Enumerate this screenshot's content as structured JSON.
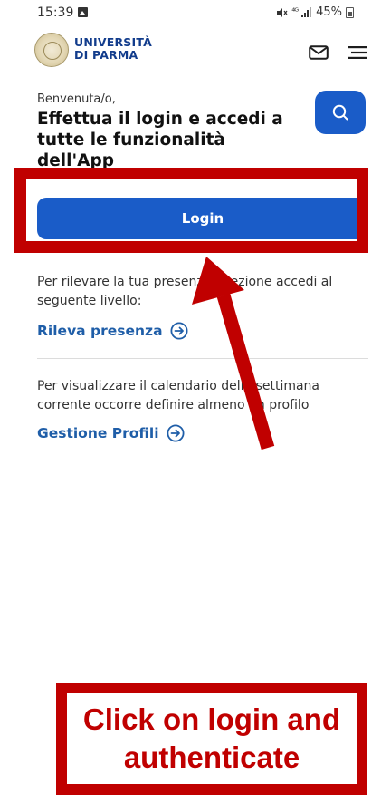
{
  "status_bar": {
    "time": "15:39",
    "signal_text": "⁴ᴳ",
    "battery": "45%"
  },
  "header": {
    "logo_line1": "UNIVERSITÀ",
    "logo_line2": "DI PARMA",
    "mail_icon": "envelope-icon",
    "menu_icon": "hamburger-menu-icon"
  },
  "welcome": {
    "greeting": "Benvenuta/o,",
    "title": "Effettua il login e accedi a tutte le funzionalità dell'App"
  },
  "search": {
    "icon": "search-icon"
  },
  "login": {
    "label": "Login"
  },
  "presence": {
    "text": "Per rilevare la tua presenza a lezione accedi al seguente livello:",
    "link_label": "Rileva presenza",
    "link_icon": "arrow-circle-right-icon"
  },
  "calendar": {
    "text": "Per visualizzare il calendario della settimana corrente occorre definire almeno un profilo",
    "link_label": "Gestione Profili",
    "link_icon": "arrow-circle-right-icon"
  },
  "annotation": {
    "instruction": "Click on login and authenticate",
    "highlight_color": "#c00000"
  },
  "colors": {
    "primary": "#1a5cc8",
    "link": "#1f5ea8",
    "annotation_red": "#c00000"
  }
}
